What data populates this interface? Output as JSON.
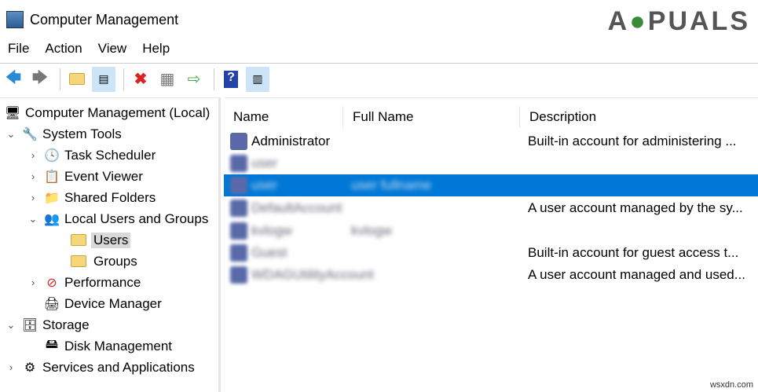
{
  "window": {
    "title": "Computer Management"
  },
  "watermark": "A PUALS",
  "menu": [
    "File",
    "Action",
    "View",
    "Help"
  ],
  "toolbar": [
    "back-icon",
    "forward-icon",
    "up-folder-icon",
    "show-hide-console-tree-icon",
    "delete-icon",
    "properties-icon",
    "export-list-icon",
    "help-icon",
    "show-hide-action-pane-icon"
  ],
  "tree": [
    {
      "label": "Computer Management (Local)"
    },
    {
      "label": "System Tools"
    },
    {
      "label": "Task Scheduler"
    },
    {
      "label": "Event Viewer"
    },
    {
      "label": "Shared Folders"
    },
    {
      "label": "Local Users and Groups"
    },
    {
      "label": "Users"
    },
    {
      "label": "Groups"
    },
    {
      "label": "Performance"
    },
    {
      "label": "Device Manager"
    },
    {
      "label": "Storage"
    },
    {
      "label": "Disk Management"
    },
    {
      "label": "Services and Applications"
    }
  ],
  "columns": [
    "Name",
    "Full Name",
    "Description"
  ],
  "users": [
    {
      "name": "Administrator",
      "full": "",
      "desc": "Built-in account for administering ..."
    },
    {
      "name": "user",
      "full": "",
      "desc": ""
    },
    {
      "name": "user",
      "full": "user fullname",
      "desc": ""
    },
    {
      "name": "DefaultAccount",
      "full": "",
      "desc": "A user account managed by the sy..."
    },
    {
      "name": "kvlogw",
      "full": "kvlogw",
      "desc": ""
    },
    {
      "name": "Guest",
      "full": "",
      "desc": "Built-in account for guest access t..."
    },
    {
      "name": "WDAGUtilityAccount",
      "full": "",
      "desc": "A user account managed and used..."
    }
  ],
  "footer": "wsxdn.com"
}
